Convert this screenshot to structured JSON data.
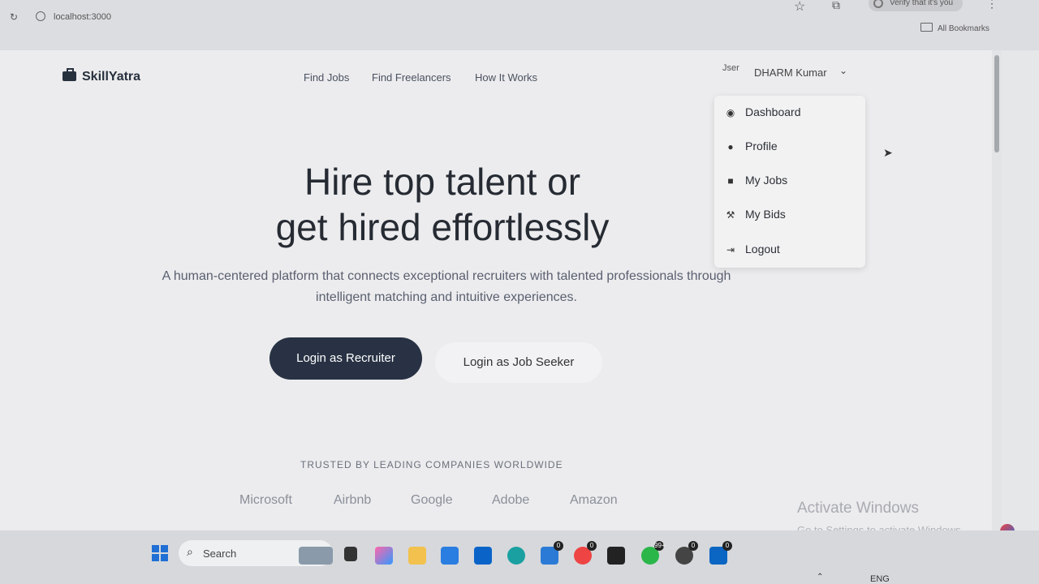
{
  "browser": {
    "url": "localhost:3000",
    "verify_label": "Verify that it's you",
    "bookmarks_label": "All Bookmarks"
  },
  "nav": {
    "brand": "SkillYatra",
    "links": [
      "Find Jobs",
      "Find Freelancers",
      "How It Works"
    ],
    "user": {
      "avatar_alt": "Jser",
      "name": "DHARM Kumar"
    }
  },
  "dropdown": {
    "items": [
      {
        "label": "Dashboard",
        "icon": "dashboard-icon"
      },
      {
        "label": "Profile",
        "icon": "user-icon"
      },
      {
        "label": "My Jobs",
        "icon": "briefcase-icon"
      },
      {
        "label": "My Bids",
        "icon": "gavel-icon"
      },
      {
        "label": "Logout",
        "icon": "logout-icon"
      }
    ]
  },
  "hero": {
    "title_line1": "Hire top talent or",
    "title_line2": "get hired effortlessly",
    "subtitle": "A human-centered platform that connects exceptional recruiters with talented professionals through intelligent matching and intuitive experiences.",
    "primary_cta": "Login as Recruiter",
    "secondary_cta": "Login as Job Seeker"
  },
  "trusted": {
    "heading": "TRUSTED BY LEADING COMPANIES WORLDWIDE",
    "companies": [
      "Microsoft",
      "Airbnb",
      "Google",
      "Adobe",
      "Amazon"
    ]
  },
  "windows": {
    "activate_title": "Activate Windows",
    "activate_sub": "Go to Settings to activate Windows."
  },
  "taskbar": {
    "search_label": "Search",
    "language": "ENG",
    "badges": [
      "0",
      "0",
      "99+",
      "0",
      "0"
    ]
  }
}
